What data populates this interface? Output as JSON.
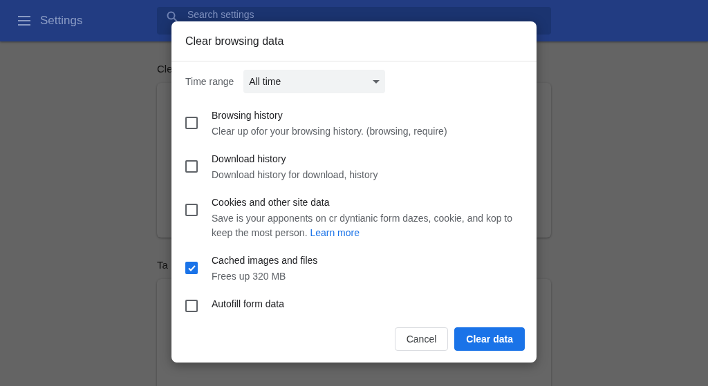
{
  "header": {
    "title": "Settings",
    "search": {
      "placeholder": "Search settings"
    }
  },
  "background_sections": [
    {
      "heading": "Cle"
    },
    {
      "heading": "Ta"
    }
  ],
  "dialog": {
    "title": "Clear browsing data",
    "time_range": {
      "label": "Time range",
      "value": "All time"
    },
    "items": [
      {
        "label": "Browsing history",
        "description": "Clear up ofor your browsing history. (browsing, require)",
        "checked": false
      },
      {
        "label": "Download history",
        "description": "Download history for download, history",
        "checked": false
      },
      {
        "label": "Cookies and other site data",
        "description": "Save is your apponents on cr dyntianic form dazes, cookie, and kop to keep the most person.",
        "link": "Learn more",
        "checked": false
      },
      {
        "label": "Cached images and files",
        "description": "Frees up 320 MB",
        "checked": true
      },
      {
        "label": "Autofill form data",
        "checked": false
      }
    ],
    "buttons": [
      {
        "label": "Cancel",
        "kind": "secondary"
      },
      {
        "label": "Clear data",
        "kind": "primary"
      }
    ]
  }
}
